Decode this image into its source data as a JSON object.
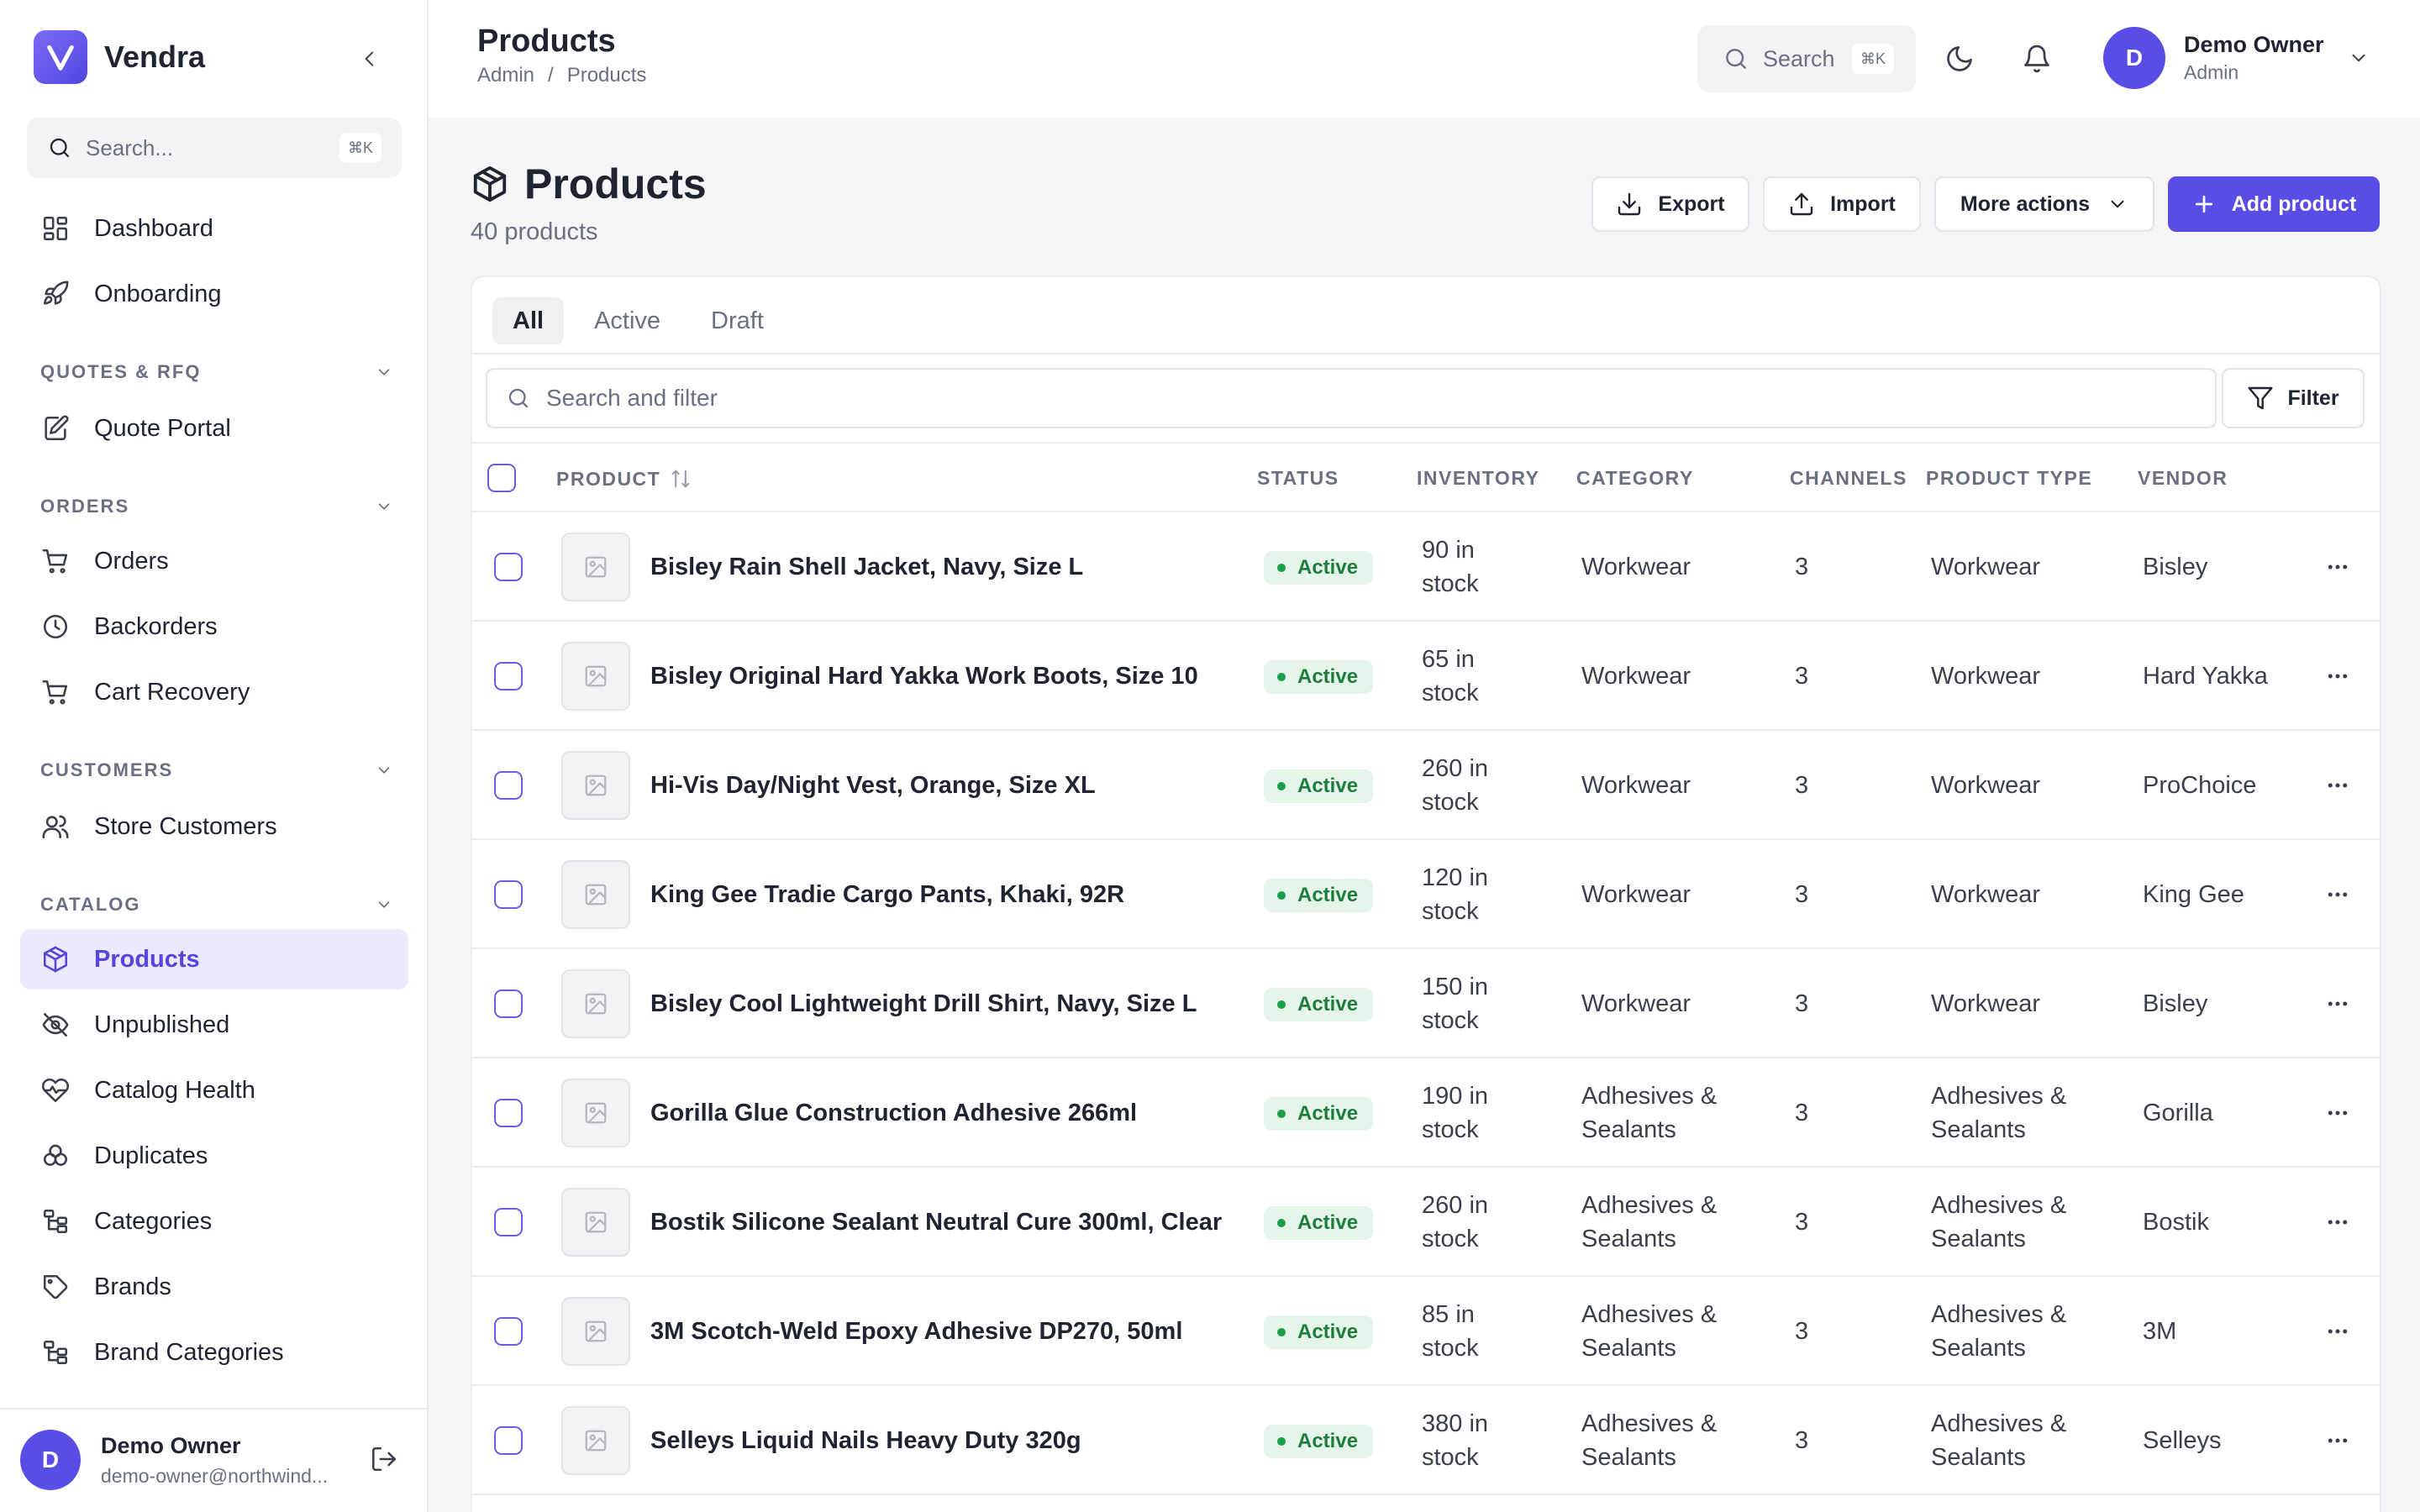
{
  "sidebar": {
    "brand": "Vendra",
    "search_placeholder": "Search...",
    "search_shortcut": "⌘K",
    "items_top": [
      {
        "label": "Dashboard",
        "icon": "dashboard-icon"
      },
      {
        "label": "Onboarding",
        "icon": "rocket-icon"
      }
    ],
    "sections": [
      {
        "title": "QUOTES & RFQ",
        "items": [
          {
            "label": "Quote Portal",
            "icon": "quote-icon"
          }
        ]
      },
      {
        "title": "ORDERS",
        "items": [
          {
            "label": "Orders",
            "icon": "cart-icon"
          },
          {
            "label": "Backorders",
            "icon": "clock-icon"
          },
          {
            "label": "Cart Recovery",
            "icon": "cart-icon"
          }
        ]
      },
      {
        "title": "CUSTOMERS",
        "items": [
          {
            "label": "Store Customers",
            "icon": "users-icon"
          }
        ]
      },
      {
        "title": "CATALOG",
        "items": [
          {
            "label": "Products",
            "icon": "package-icon",
            "active": true
          },
          {
            "label": "Unpublished",
            "icon": "eye-off-icon"
          },
          {
            "label": "Catalog Health",
            "icon": "heart-pulse-icon"
          },
          {
            "label": "Duplicates",
            "icon": "duplicates-icon"
          },
          {
            "label": "Categories",
            "icon": "hierarchy-icon"
          },
          {
            "label": "Brands",
            "icon": "tag-icon"
          },
          {
            "label": "Brand Categories",
            "icon": "hierarchy-icon"
          }
        ]
      }
    ],
    "footer": {
      "initial": "D",
      "name": "Demo Owner",
      "email": "demo-owner@northwind..."
    }
  },
  "header": {
    "title": "Products",
    "breadcrumb": [
      "Admin",
      "/",
      "Products"
    ],
    "search_label": "Search",
    "search_shortcut": "⌘K",
    "user": {
      "initial": "D",
      "name": "Demo Owner",
      "role": "Admin"
    }
  },
  "page": {
    "title": "Products",
    "subtitle": "40 products",
    "buttons": {
      "export": "Export",
      "import": "Import",
      "more": "More actions",
      "add": "Add product"
    }
  },
  "table": {
    "tabs": [
      {
        "label": "All",
        "active": true
      },
      {
        "label": "Active"
      },
      {
        "label": "Draft"
      }
    ],
    "filter_placeholder": "Search and filter",
    "filter_button": "Filter",
    "columns": {
      "product": "PRODUCT",
      "status": "STATUS",
      "inventory": "INVENTORY",
      "category": "CATEGORY",
      "channels": "CHANNELS",
      "product_type": "PRODUCT TYPE",
      "vendor": "VENDOR"
    },
    "rows": [
      {
        "name": "Bisley Rain Shell Jacket, Navy, Size L",
        "status": "Active",
        "inventory": "90 in stock",
        "category": "Workwear",
        "channels": "3",
        "type": "Workwear",
        "vendor": "Bisley"
      },
      {
        "name": "Bisley Original Hard Yakka Work Boots, Size 10",
        "status": "Active",
        "inventory": "65 in stock",
        "category": "Workwear",
        "channels": "3",
        "type": "Workwear",
        "vendor": "Hard Yakka"
      },
      {
        "name": "Hi-Vis Day/Night Vest, Orange, Size XL",
        "status": "Active",
        "inventory": "260 in stock",
        "category": "Workwear",
        "channels": "3",
        "type": "Workwear",
        "vendor": "ProChoice"
      },
      {
        "name": "King Gee Tradie Cargo Pants, Khaki, 92R",
        "status": "Active",
        "inventory": "120 in stock",
        "category": "Workwear",
        "channels": "3",
        "type": "Workwear",
        "vendor": "King Gee"
      },
      {
        "name": "Bisley Cool Lightweight Drill Shirt, Navy, Size L",
        "status": "Active",
        "inventory": "150 in stock",
        "category": "Workwear",
        "channels": "3",
        "type": "Workwear",
        "vendor": "Bisley"
      },
      {
        "name": "Gorilla Glue Construction Adhesive 266ml",
        "status": "Active",
        "inventory": "190 in stock",
        "category": "Adhesives & Sealants",
        "channels": "3",
        "type": "Adhesives & Sealants",
        "vendor": "Gorilla"
      },
      {
        "name": "Bostik Silicone Sealant Neutral Cure 300ml, Clear",
        "status": "Active",
        "inventory": "260 in stock",
        "category": "Adhesives & Sealants",
        "channels": "3",
        "type": "Adhesives & Sealants",
        "vendor": "Bostik"
      },
      {
        "name": "3M Scotch-Weld Epoxy Adhesive DP270, 50ml",
        "status": "Active",
        "inventory": "85 in stock",
        "category": "Adhesives & Sealants",
        "channels": "3",
        "type": "Adhesives & Sealants",
        "vendor": "3M"
      },
      {
        "name": "Selleys Liquid Nails Heavy Duty 320g",
        "status": "Active",
        "inventory": "380 in stock",
        "category": "Adhesives & Sealants",
        "channels": "3",
        "type": "Adhesives & Sealants",
        "vendor": "Selleys"
      }
    ]
  },
  "colors": {
    "accent": "#5a4de6",
    "active_bg": "#ebeafc",
    "status_bg": "#e5f5ea",
    "status_text": "#1e7c3c"
  }
}
